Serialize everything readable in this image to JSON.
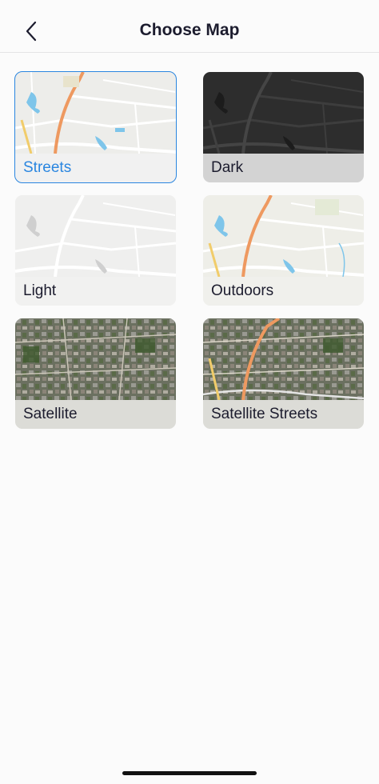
{
  "header": {
    "title": "Choose Map",
    "back_icon": "chevron-left-icon"
  },
  "maps": [
    {
      "label": "Streets",
      "selected": true
    },
    {
      "label": "Dark",
      "selected": false
    },
    {
      "label": "Light",
      "selected": false
    },
    {
      "label": "Outdoors",
      "selected": false
    },
    {
      "label": "Satellite",
      "selected": false
    },
    {
      "label": "Satellite Streets",
      "selected": false
    }
  ],
  "colors": {
    "accent": "#2a86e0",
    "text": "#1c1c2e"
  }
}
